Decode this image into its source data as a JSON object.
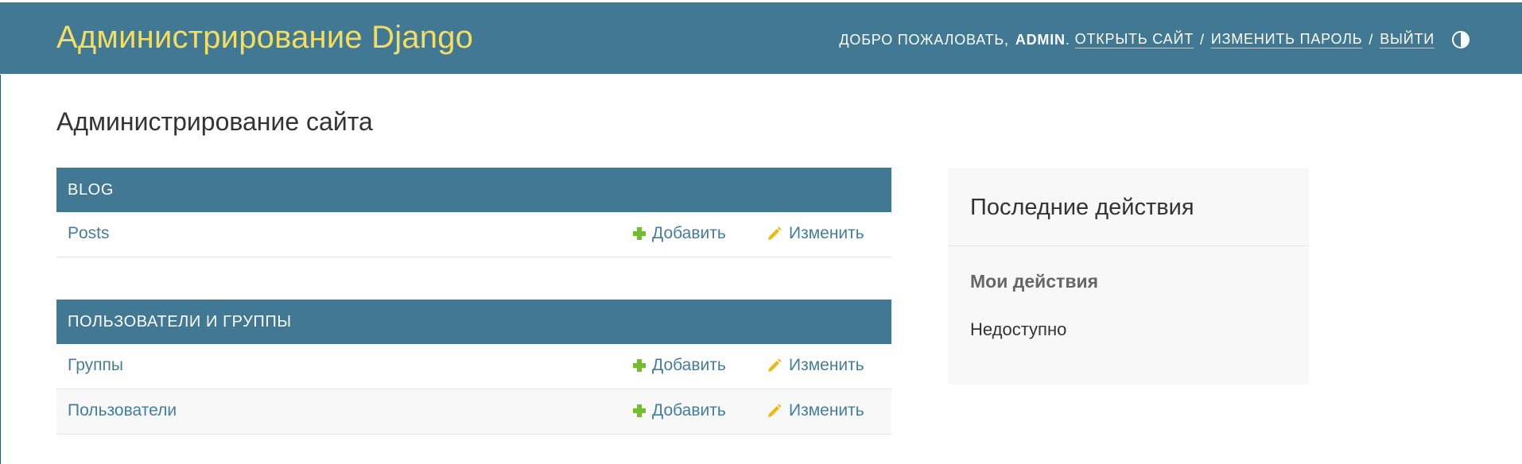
{
  "header": {
    "site_title": "Администрирование Django",
    "welcome": "Добро пожаловать,",
    "username": "admin",
    "username_suffix": ".",
    "view_site": "Открыть сайт",
    "change_password": "Изменить пароль",
    "logout": "Выйти",
    "separator": "/",
    "theme_toggle_icon": "half-circle-contrast-icon"
  },
  "page": {
    "title": "Администрирование сайта"
  },
  "apps": [
    {
      "caption": "Blog",
      "models": [
        {
          "name": "Posts",
          "add_label": "Добавить",
          "change_label": "Изменить"
        }
      ]
    },
    {
      "caption": "Пользователи и группы",
      "models": [
        {
          "name": "Группы",
          "add_label": "Добавить",
          "change_label": "Изменить"
        },
        {
          "name": "Пользователи",
          "add_label": "Добавить",
          "change_label": "Изменить"
        }
      ]
    }
  ],
  "recent_actions": {
    "title": "Последние действия",
    "subtitle": "Мои действия",
    "empty_text": "Недоступно"
  },
  "colors": {
    "header_bg": "#417893",
    "branding": "#f5dd5d",
    "link": "#447e9b",
    "add_icon": "#70bf2b",
    "change_icon": "#efb80b"
  }
}
